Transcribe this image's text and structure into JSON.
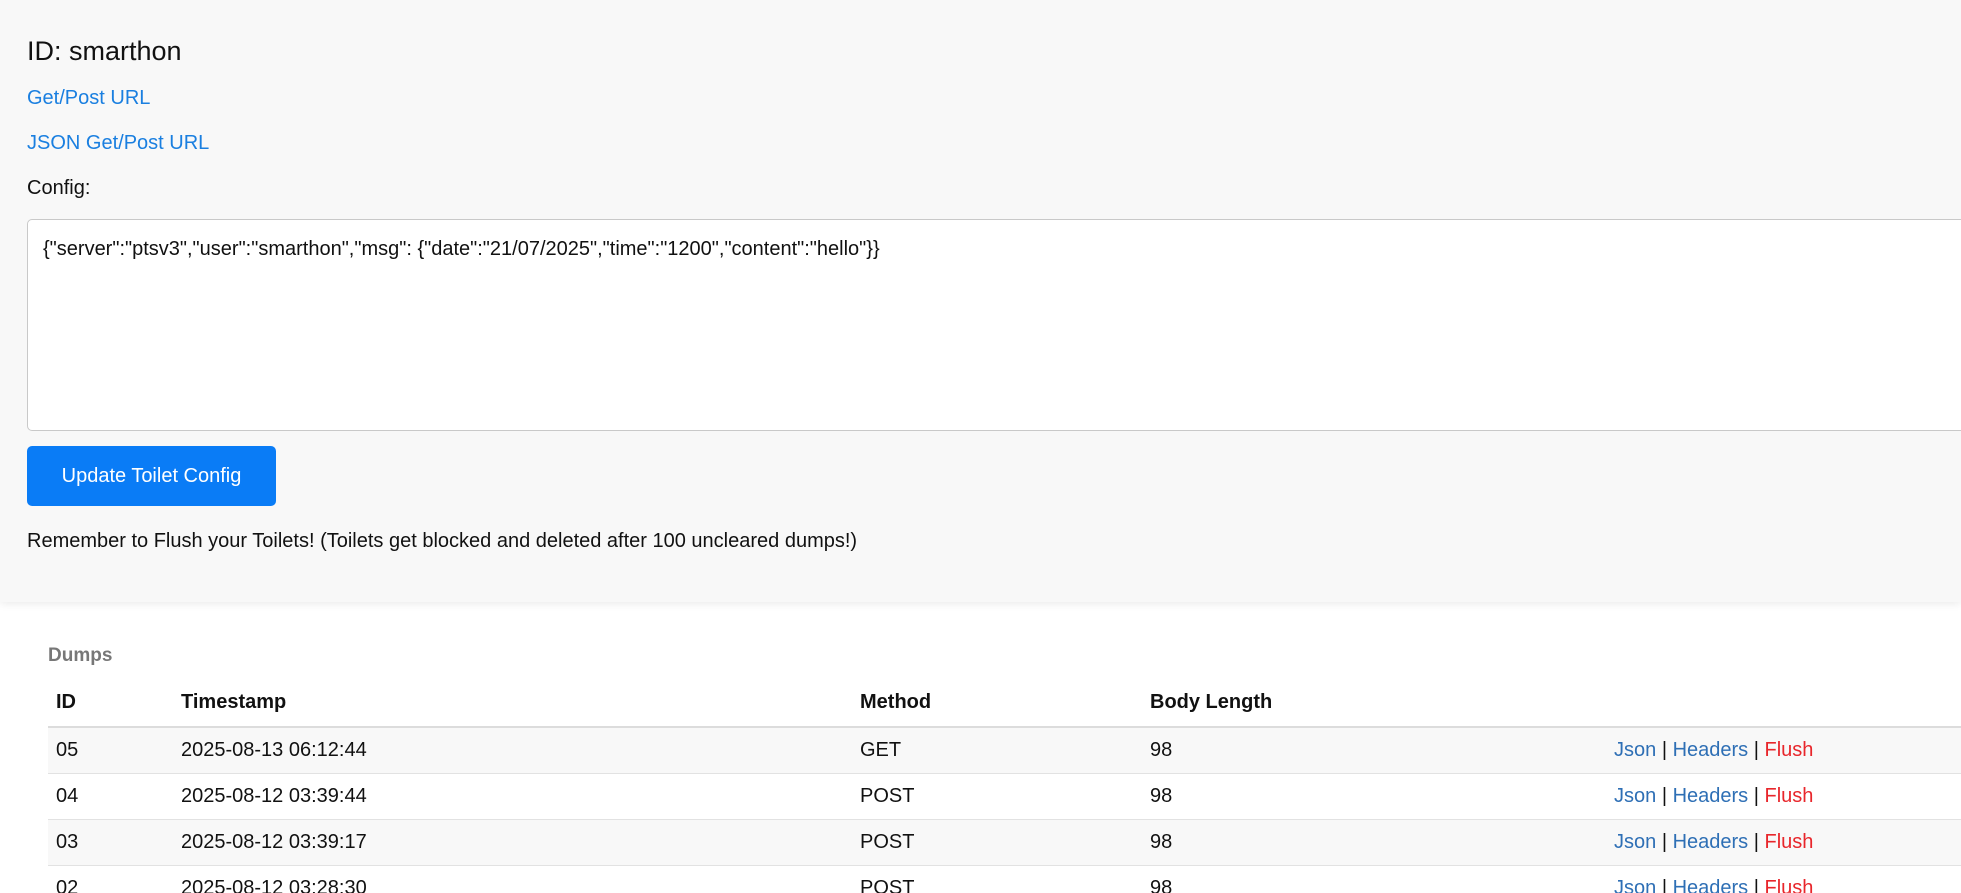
{
  "toilet": {
    "id_label": "ID: smarthon",
    "get_post_link": "Get/Post URL",
    "json_get_post_link": "JSON Get/Post URL",
    "config_label": "Config:",
    "config_value": "{\"server\":\"ptsv3\",\"user\":\"smarthon\",\"msg\": {\"date\":\"21/07/2025\",\"time\":\"1200\",\"content\":\"hello\"}}",
    "update_button": "Update Toilet Config",
    "reminder": "Remember to Flush your Toilets! (Toilets get blocked and deleted after 100 uncleared dumps!)"
  },
  "dumps": {
    "title": "Dumps",
    "headers": [
      "ID",
      "Timestamp",
      "Method",
      "Body Length"
    ],
    "actions": {
      "json": "Json",
      "headers": "Headers",
      "flush": "Flush",
      "separator": "|"
    },
    "rows": [
      {
        "id": "05",
        "timestamp": "2025-08-13 06:12:44",
        "method": "GET",
        "body_length": "98"
      },
      {
        "id": "04",
        "timestamp": "2025-08-12 03:39:44",
        "method": "POST",
        "body_length": "98"
      },
      {
        "id": "03",
        "timestamp": "2025-08-12 03:39:17",
        "method": "POST",
        "body_length": "98"
      },
      {
        "id": "02",
        "timestamp": "2025-08-12 03:28:30",
        "method": "POST",
        "body_length": "98"
      }
    ]
  },
  "colors": {
    "link": "#1a7fe0",
    "button": "#0a7cf6",
    "flush": "#e8262b"
  }
}
